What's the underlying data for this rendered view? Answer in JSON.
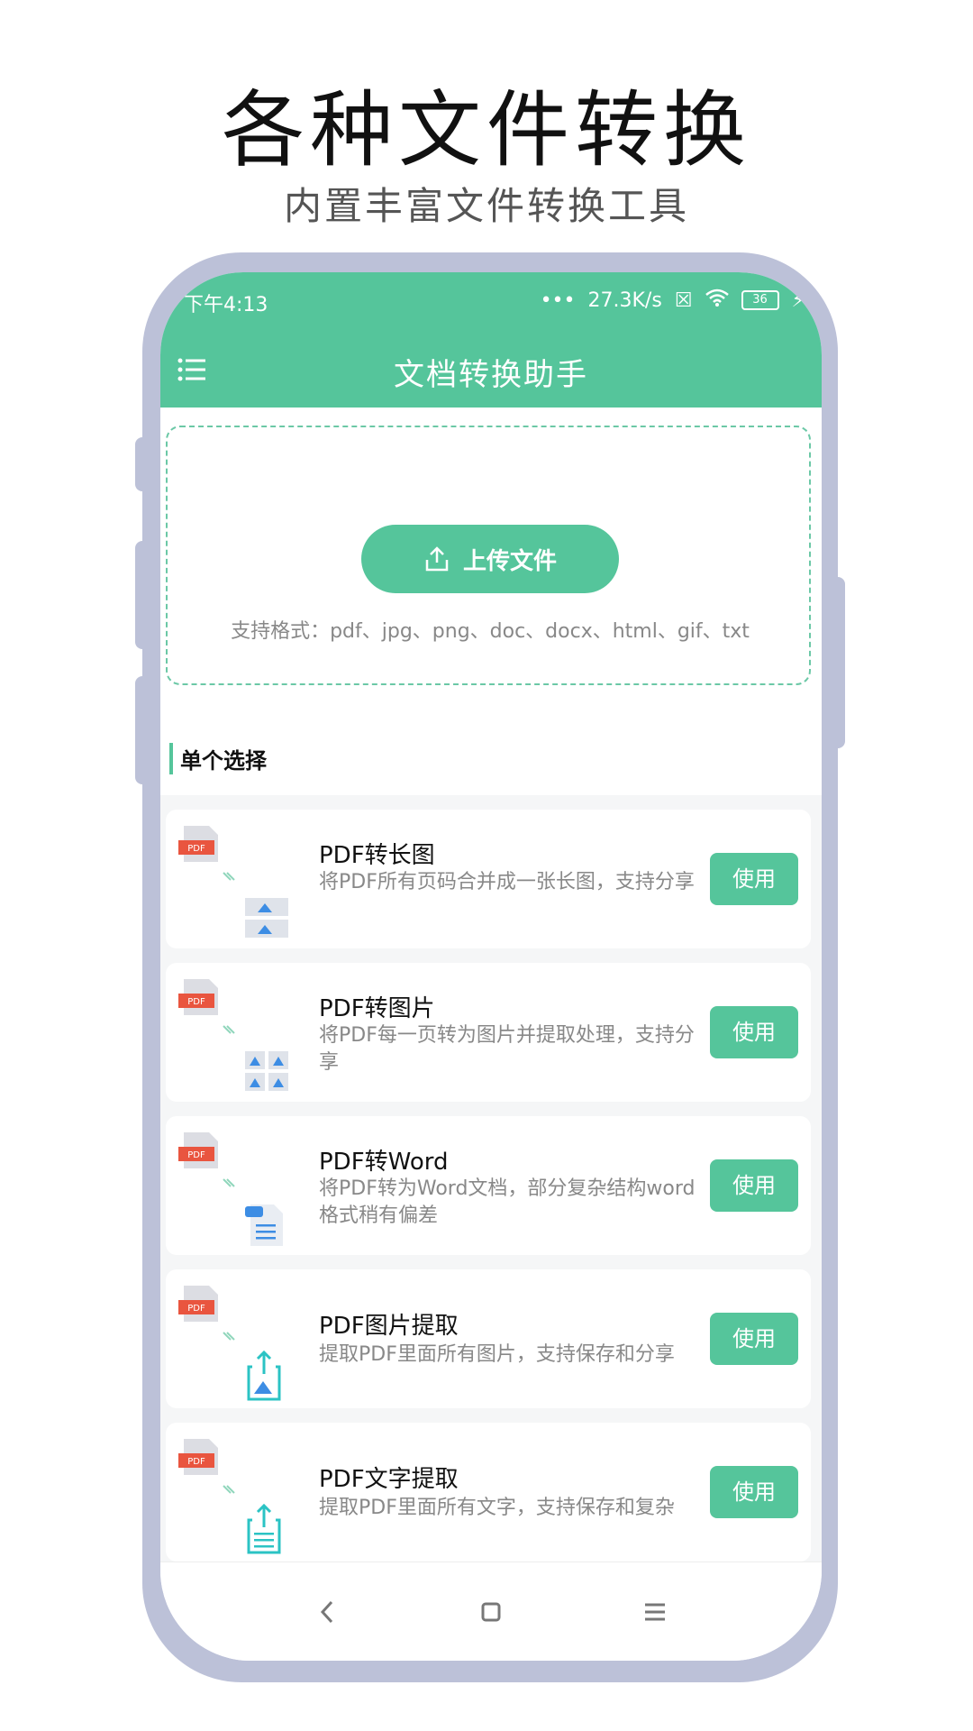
{
  "promo": {
    "headline": "各种文件转换",
    "subline": "内置丰富文件转换工具"
  },
  "status": {
    "time": "下午4:13",
    "speed": "27.3K/s",
    "battery": "36"
  },
  "header": {
    "title": "文档转换助手"
  },
  "upload": {
    "button_label": "上传文件",
    "formats": "支持格式：pdf、jpg、png、doc、docx、html、gif、txt"
  },
  "section": {
    "title": "单个选择"
  },
  "tools": [
    {
      "title": "PDF转长图",
      "desc": "将PDF所有页码合并成一张长图，支持分享",
      "button": "使用",
      "icon": "long-image-icon"
    },
    {
      "title": "PDF转图片",
      "desc": "将PDF每一页转为图片并提取处理，支持分享",
      "button": "使用",
      "icon": "image-grid-icon"
    },
    {
      "title": "PDF转Word",
      "desc": "将PDF转为Word文档，部分复杂结构word格式稍有偏差",
      "button": "使用",
      "icon": "word-doc-icon"
    },
    {
      "title": "PDF图片提取",
      "desc": "提取PDF里面所有图片，支持保存和分享",
      "button": "使用",
      "icon": "extract-image-icon"
    },
    {
      "title": "PDF文字提取",
      "desc": "提取PDF里面所有文字，支持保存和复杂",
      "button": "使用",
      "icon": "extract-text-icon"
    }
  ],
  "pdf_badge": "PDF",
  "colors": {
    "accent": "#55c59b",
    "frame": "#bcc1d8",
    "pdf_red": "#e9553f"
  }
}
